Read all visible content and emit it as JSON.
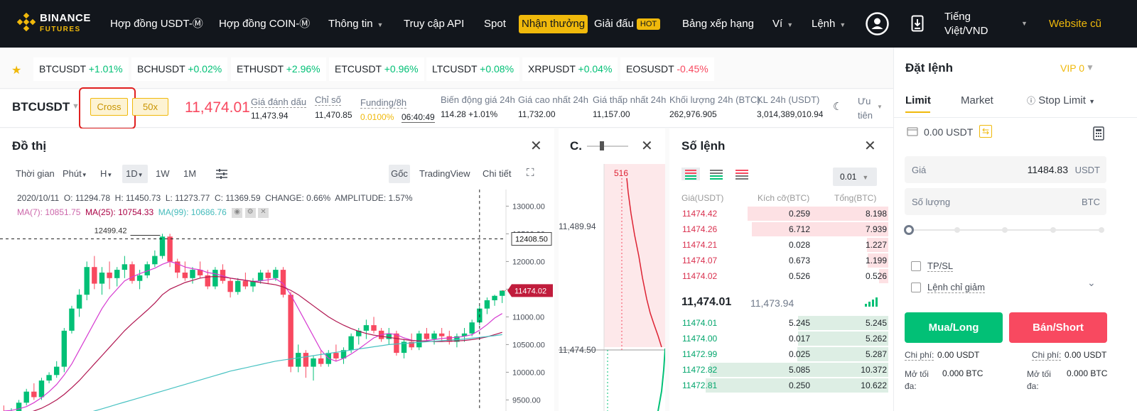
{
  "nav": {
    "logo_top": "BINANCE",
    "logo_bottom": "FUTURES",
    "items": [
      "Hợp đồng USDT-Ⓜ",
      "Hợp đồng COIN-Ⓜ",
      "Thông tin",
      "Truy cập API",
      "Spot",
      "Nhận thưởng",
      "Giải đấu",
      "Bảng xếp hạng",
      "Ví",
      "Lệnh"
    ],
    "hot": "HOT",
    "lang_line1": "Tiếng",
    "lang_line2": "Việt/VND",
    "old_site": "Website cũ"
  },
  "tickers": [
    {
      "sym": "BTCUSDT",
      "chg": "+1.01%",
      "dir": "up"
    },
    {
      "sym": "BCHUSDT",
      "chg": "+0.02%",
      "dir": "up"
    },
    {
      "sym": "ETHUSDT",
      "chg": "+2.96%",
      "dir": "up"
    },
    {
      "sym": "ETCUSDT",
      "chg": "+0.96%",
      "dir": "up"
    },
    {
      "sym": "LTCUSDT",
      "chg": "+0.08%",
      "dir": "up"
    },
    {
      "sym": "XRPUSDT",
      "chg": "+0.04%",
      "dir": "up"
    },
    {
      "sym": "EOSUSDT",
      "chg": "-0.45%",
      "dir": "dn"
    }
  ],
  "symbol": {
    "name": "BTCUSDT",
    "margin": "Cross",
    "leverage": "50x",
    "last": "11,474.01",
    "mark_label": "Giá đánh dấu",
    "mark": "11,473.94",
    "index_label": "Chỉ số",
    "index": "11,470.85",
    "funding_label": "Funding/8h",
    "funding": "0.0100%",
    "countdown": "06:40:49",
    "chg_label": "Biến động giá 24h",
    "chg": "114.28 +1.01%",
    "high_label": "Giá cao nhất 24h",
    "high": "11,732.00",
    "low_label": "Giá thấp nhất 24h",
    "low": "11,157.00",
    "vol_label": "Khối lượng 24h (BTC)",
    "vol": "262,976.905",
    "kl_label": "KL 24h (USDT)",
    "kl": "3,014,389,010.94",
    "pref_line1": "Ưu",
    "pref_line2": "tiên"
  },
  "chart": {
    "title": "Đồ thị",
    "toolbar": [
      "Thời gian",
      "Phút",
      "H",
      "1D",
      "1W",
      "1M"
    ],
    "right_tools": [
      "Gốc",
      "TradingView",
      "Chi tiết"
    ],
    "ohlc": "2020/10/11  O: 11294.78  H: 11450.73  L: 11273.77  C: 11369.59  CHANGE: 0.66%  AMPLITUDE: 1.57%",
    "ma7": "MA(7): 10851.75",
    "ma25": "MA(25): 10754.33",
    "ma99": "MA(99): 10686.76",
    "peak_label": "12499.42",
    "cross_label": "12408.50",
    "last_label": "11474.02",
    "yticks": [
      "13000.00",
      "12500.00",
      "12000.00",
      "11500.00",
      "11000.00",
      "10500.00",
      "10000.00",
      "9500.00"
    ]
  },
  "depth": {
    "title": "C.",
    "top_label": "516",
    "y1": "11,489.94",
    "y2": "11,474.50"
  },
  "orderbook": {
    "title": "Số lệnh",
    "precision": "0.01",
    "headers": [
      "Giá(USDT)",
      "Kích cỡ(BTC)",
      "Tổng(BTC)"
    ],
    "asks": [
      [
        "11474.42",
        "0.259",
        "8.198"
      ],
      [
        "11474.26",
        "6.712",
        "7.939"
      ],
      [
        "11474.21",
        "0.028",
        "1.227"
      ],
      [
        "11474.07",
        "0.673",
        "1.199"
      ],
      [
        "11474.02",
        "0.526",
        "0.526"
      ]
    ],
    "last": "11,474.01",
    "mark": "11,473.94",
    "bids": [
      [
        "11474.01",
        "5.245",
        "5.245"
      ],
      [
        "11474.00",
        "0.017",
        "5.262"
      ],
      [
        "11472.99",
        "0.025",
        "5.287"
      ],
      [
        "11472.82",
        "5.085",
        "10.372"
      ],
      [
        "11472.81",
        "0.250",
        "10.622"
      ]
    ]
  },
  "order": {
    "title": "Đặt lệnh",
    "vip": "VIP 0",
    "tabs": [
      "Limit",
      "Market",
      "Stop Limit"
    ],
    "balance": "0.00 USDT",
    "price_label": "Giá",
    "price": "11484.83",
    "price_unit": "USDT",
    "qty_label": "Số lượng",
    "qty_unit": "BTC",
    "tpsl": "TP/SL",
    "reduce": "Lệnh chỉ giảm",
    "buy": "Mua/Long",
    "sell": "Bán/Short",
    "cost_label": "Chi phí:",
    "cost_buy": "0.00 USDT",
    "cost_sell": "0.00 USDT",
    "max_line1": "Mở tối",
    "max_line2": "đa:",
    "max_buy": "0.000 BTC",
    "max_sell": "0.000 BTC"
  },
  "chart_data": {
    "type": "candlestick",
    "ohlc": [
      [
        9300,
        9400,
        9100,
        9200
      ],
      [
        9200,
        9350,
        9150,
        9300
      ],
      [
        9300,
        9500,
        9250,
        9450
      ],
      [
        9450,
        9700,
        9400,
        9650
      ],
      [
        9650,
        9800,
        9500,
        9550
      ],
      [
        9550,
        9900,
        9500,
        9850
      ],
      [
        9850,
        10000,
        9800,
        9950
      ],
      [
        9950,
        10200,
        9900,
        10100
      ],
      [
        10100,
        10800,
        10000,
        10750
      ],
      [
        10750,
        11200,
        10700,
        11150
      ],
      [
        11150,
        11500,
        11000,
        11400
      ],
      [
        11400,
        12000,
        11300,
        11900
      ],
      [
        11900,
        12100,
        11500,
        11600
      ],
      [
        11600,
        11900,
        11400,
        11800
      ],
      [
        11800,
        12000,
        11500,
        11700
      ],
      [
        11700,
        11900,
        11550,
        11850
      ],
      [
        11850,
        12100,
        11700,
        11950
      ],
      [
        11950,
        12000,
        11600,
        11650
      ],
      [
        11650,
        11850,
        11500,
        11750
      ],
      [
        11750,
        12000,
        11700,
        11950
      ],
      [
        11950,
        12200,
        11900,
        12100
      ],
      [
        12100,
        12500,
        12050,
        12450
      ],
      [
        12450,
        12500,
        11900,
        12000
      ],
      [
        12000,
        12050,
        11700,
        11800
      ],
      [
        11800,
        12000,
        11650,
        11700
      ],
      [
        11700,
        11900,
        11600,
        11850
      ],
      [
        11850,
        12000,
        11700,
        11750
      ],
      [
        11750,
        11850,
        11500,
        11550
      ],
      [
        11550,
        11900,
        11500,
        11850
      ],
      [
        11850,
        11950,
        11600,
        11650
      ],
      [
        11650,
        11700,
        11350,
        11450
      ],
      [
        11450,
        11700,
        11400,
        11650
      ],
      [
        11650,
        11800,
        11500,
        11550
      ],
      [
        11550,
        11700,
        11450,
        11650
      ],
      [
        11650,
        11850,
        11600,
        11800
      ],
      [
        11800,
        11850,
        11600,
        11700
      ],
      [
        11700,
        11900,
        11650,
        11850
      ],
      [
        11850,
        11900,
        11350,
        11400
      ],
      [
        11400,
        11450,
        10000,
        10100
      ],
      [
        10100,
        10500,
        10000,
        10350
      ],
      [
        10350,
        10400,
        9900,
        10100
      ],
      [
        10100,
        10300,
        9850,
        10250
      ],
      [
        10250,
        10400,
        10100,
        10150
      ],
      [
        10150,
        10400,
        10100,
        10350
      ],
      [
        10350,
        10500,
        10200,
        10250
      ],
      [
        10250,
        10450,
        10150,
        10400
      ],
      [
        10400,
        10700,
        10350,
        10650
      ],
      [
        10650,
        10800,
        10500,
        10750
      ],
      [
        10750,
        10950,
        10600,
        10850
      ],
      [
        10850,
        11000,
        10700,
        10750
      ],
      [
        10750,
        10800,
        10550,
        10600
      ],
      [
        10600,
        10800,
        10500,
        10700
      ],
      [
        10700,
        10750,
        10300,
        10350
      ],
      [
        10350,
        10600,
        10250,
        10550
      ],
      [
        10550,
        10700,
        10400,
        10450
      ],
      [
        10450,
        10750,
        10400,
        10700
      ],
      [
        10700,
        10800,
        10550,
        10600
      ],
      [
        10600,
        10750,
        10500,
        10700
      ],
      [
        10700,
        10800,
        10550,
        10650
      ],
      [
        10650,
        10750,
        10500,
        10550
      ],
      [
        10550,
        10700,
        10450,
        10650
      ],
      [
        10650,
        10800,
        10550,
        10700
      ],
      [
        10700,
        10950,
        10650,
        10900
      ],
      [
        10900,
        11200,
        10850,
        11150
      ],
      [
        11150,
        11350,
        11050,
        11300
      ],
      [
        11300,
        11400,
        11200,
        11380
      ],
      [
        11380,
        11480,
        11250,
        11474
      ]
    ],
    "ma7": [
      9300,
      9310,
      9340,
      9380,
      9450,
      9540,
      9650,
      9780,
      9950,
      10150,
      10400,
      10650,
      10900,
      11150,
      11350,
      11500,
      11650,
      11720,
      11780,
      11830,
      11880,
      11950,
      12000,
      11960,
      11900,
      11870,
      11850,
      11800,
      11780,
      11740,
      11700,
      11680,
      11660,
      11640,
      11650,
      11670,
      11690,
      11600,
      11400,
      11150,
      10900,
      10650,
      10400,
      10250,
      10200,
      10250,
      10330,
      10420,
      10520,
      10620,
      10680,
      10700,
      10680,
      10620,
      10580,
      10560,
      10570,
      10590,
      10610,
      10620,
      10630,
      10650,
      10680,
      10760,
      10860,
      10980,
      11060
    ],
    "ma25": [
      9200,
      9210,
      9230,
      9260,
      9300,
      9350,
      9420,
      9500,
      9600,
      9720,
      9850,
      10000,
      10150,
      10300,
      10450,
      10600,
      10750,
      10880,
      11000,
      11120,
      11250,
      11400,
      11500,
      11560,
      11620,
      11660,
      11700,
      11720,
      11730,
      11720,
      11700,
      11680,
      11660,
      11640,
      11620,
      11600,
      11580,
      11540,
      11480,
      11400,
      11300,
      11200,
      11100,
      11000,
      10920,
      10850,
      10790,
      10740,
      10700,
      10670,
      10650,
      10630,
      10610,
      10590,
      10575,
      10565,
      10560,
      10555,
      10555,
      10560,
      10565,
      10575,
      10590,
      10610,
      10640,
      10680,
      10720
    ],
    "ma99": [
      9000,
      9020,
      9040,
      9060,
      9080,
      9100,
      9120,
      9140,
      9170,
      9200,
      9230,
      9260,
      9300,
      9340,
      9380,
      9420,
      9460,
      9500,
      9540,
      9580,
      9620,
      9660,
      9700,
      9740,
      9780,
      9820,
      9860,
      9900,
      9940,
      9980,
      10020,
      10050,
      10080,
      10110,
      10140,
      10170,
      10200,
      10220,
      10240,
      10260,
      10280,
      10300,
      10320,
      10340,
      10360,
      10380,
      10400,
      10420,
      10440,
      10460,
      10480,
      10500,
      10510,
      10520,
      10530,
      10540,
      10550,
      10560,
      10570,
      10580,
      10590,
      10600,
      10615,
      10630,
      10645,
      10660,
      10680
    ],
    "ylim": [
      9300,
      13300
    ]
  }
}
